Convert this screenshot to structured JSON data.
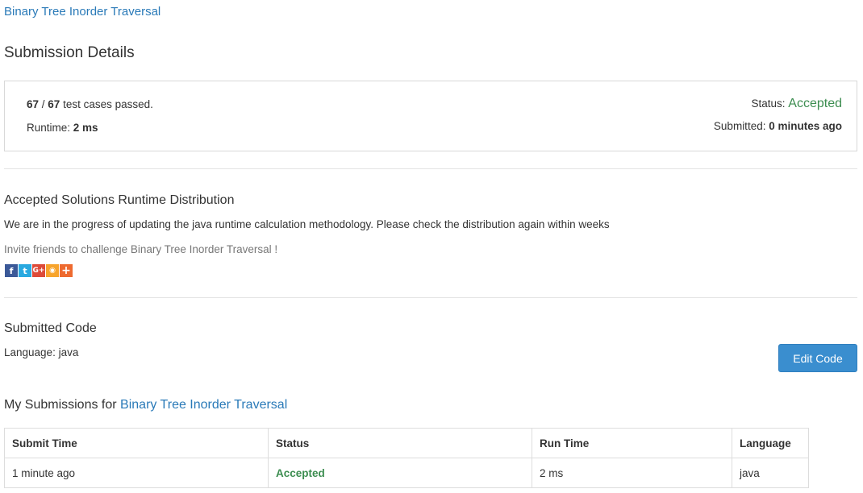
{
  "problem_link": "Binary Tree Inorder Traversal",
  "page_title": "Submission Details",
  "result": {
    "passed": "67",
    "separator": " / ",
    "total": "67",
    "passed_suffix": " test cases passed.",
    "runtime_label": "Runtime: ",
    "runtime_value": "2 ms",
    "status_label": "Status: ",
    "status_value": "Accepted",
    "submitted_label": "Submitted: ",
    "submitted_value": "0 minutes ago"
  },
  "distribution": {
    "title": "Accepted Solutions Runtime Distribution",
    "note": "We are in the progress of updating the java runtime calculation methodology. Please check the distribution again within weeks",
    "invite": "Invite friends to challenge Binary Tree Inorder Traversal !"
  },
  "share": [
    {
      "icon": "facebook-icon",
      "glyph": "f",
      "color": "#3b5998"
    },
    {
      "icon": "twitter-icon",
      "glyph": "t",
      "color": "#29a9e0"
    },
    {
      "icon": "google-plus-icon",
      "glyph": "G+",
      "color": "#dd4b39"
    },
    {
      "icon": "weibo-icon",
      "glyph": "◉",
      "color": "#f7a42c"
    },
    {
      "icon": "more-share-icon",
      "glyph": "+",
      "color": "#ee6a2f"
    }
  ],
  "code": {
    "title": "Submitted Code",
    "language": "Language: java",
    "edit_button": "Edit Code"
  },
  "submissions": {
    "heading_prefix": "My Submissions for ",
    "heading_link": "Binary Tree Inorder Traversal",
    "columns": [
      "Submit Time",
      "Status",
      "Run Time",
      "Language"
    ],
    "rows": [
      [
        "1 minute ago",
        "Accepted",
        "2 ms",
        "java"
      ]
    ]
  },
  "colors": {
    "link": "#2a7ab8",
    "accepted": "#3c8d50",
    "button": "#3a8ecf"
  }
}
